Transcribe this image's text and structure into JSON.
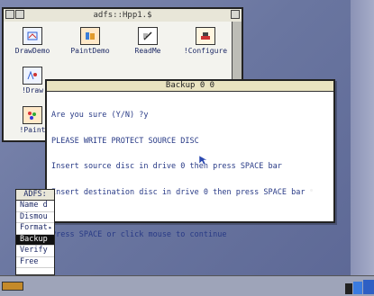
{
  "filer": {
    "title": "adfs::Hpp1.$",
    "icons": [
      {
        "name": "DrawDemo"
      },
      {
        "name": "PaintDemo"
      },
      {
        "name": "ReadMe"
      },
      {
        "name": "!Configure"
      },
      {
        "name": "!Draw"
      },
      {
        "name": "!Paint"
      }
    ]
  },
  "dialog": {
    "title": "Backup 0 0",
    "lines": [
      "Are you sure (Y/N) ?y",
      "PLEASE WRITE PROTECT SOURCE DISC",
      "Insert source disc in drive 0 then press SPACE bar",
      "Insert destination disc in drive 0 then press SPACE bar",
      "",
      "Press SPACE or click mouse to continue"
    ]
  },
  "menu": {
    "title": "ADFS:",
    "items": [
      {
        "label": "Name d"
      },
      {
        "label": "Dismou"
      },
      {
        "label": "Format"
      },
      {
        "label": "Backup"
      },
      {
        "label": "Verify"
      },
      {
        "label": "Free"
      }
    ]
  },
  "colors": {
    "desktop": "#6e7aa3",
    "dialog_text": "#283a86",
    "selected_menu": "#111111"
  }
}
